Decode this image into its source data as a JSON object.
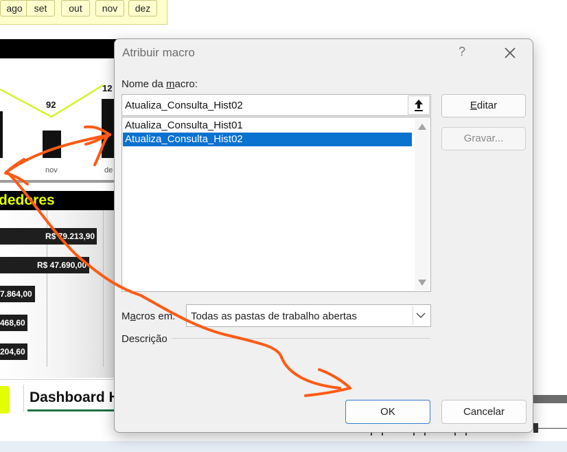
{
  "background": {
    "months": [
      "ago",
      "set",
      "out",
      "nov",
      "dez"
    ],
    "chart": {
      "value_labels": [
        "92",
        "12"
      ],
      "x_labels": [
        "nov",
        "de"
      ]
    },
    "vendedores_title": "dedores",
    "seller_values": [
      "R$ 79.213,90",
      "R$ 47.690,00",
      "7.864,00",
      "468,60",
      "204,60"
    ],
    "sheet_tab": "Dashboard H",
    "colors": {
      "accent_yellow": "#e2ff00",
      "tab_green": "#1e7145"
    }
  },
  "dialog": {
    "title": "Atribuir macro",
    "help_glyph": "?",
    "close_glyph": "×",
    "macro_name_label": {
      "pre": "Nome da ",
      "underlined": "m",
      "post": "acro:"
    },
    "macro_name_value": "Atualiza_Consulta_Hist02",
    "macros": [
      {
        "name": "Atualiza_Consulta_Hist01",
        "selected": false
      },
      {
        "name": "Atualiza_Consulta_Hist02",
        "selected": true
      }
    ],
    "edit_button": {
      "underlined": "E",
      "post": "ditar"
    },
    "record_button": "Gravar...",
    "macros_in_label": {
      "pre": "M",
      "underlined": "a",
      "post": "cros em:"
    },
    "macros_in_value": "Todas as pastas de trabalho abertas",
    "description_label": "Descrição",
    "ok_button": "OK",
    "cancel_button": "Cancelar",
    "colors": {
      "selection": "#0a72cf",
      "annotation": "#ff5a14"
    }
  }
}
